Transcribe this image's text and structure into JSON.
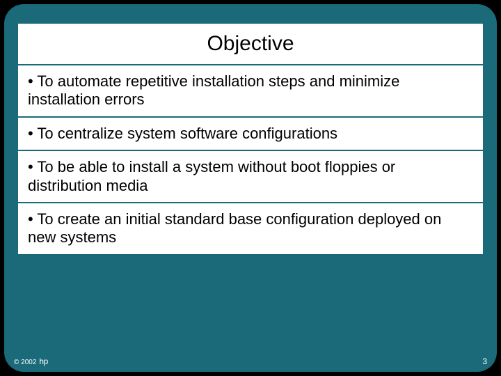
{
  "title": "Objective",
  "bullets": [
    "• To automate repetitive installation steps and minimize installation errors",
    "• To centralize system software configurations",
    "• To be able to install a system without boot floppies or distribution media",
    "• To create an initial standard base configuration deployed on new systems"
  ],
  "footer": {
    "copyright": "© 2002",
    "logo": "hp",
    "page": "3"
  }
}
